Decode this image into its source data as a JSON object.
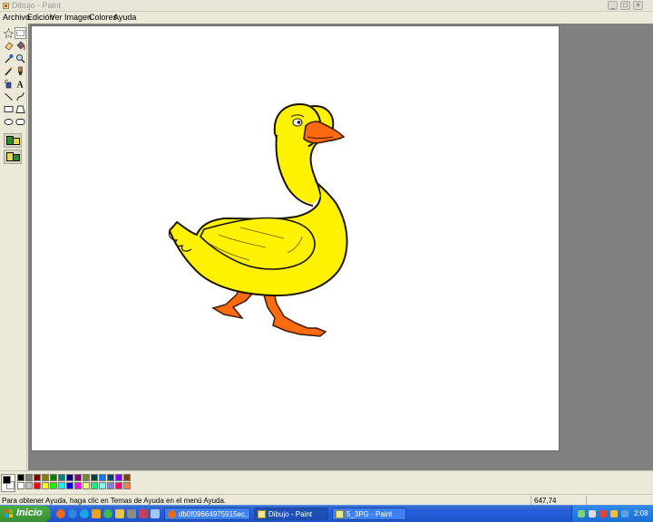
{
  "window": {
    "title": "Dibujo - Paint",
    "controls": {
      "minimize": "_",
      "maximize": "□",
      "close": "×"
    }
  },
  "menu": [
    "Archivo",
    "Edición",
    "Ver",
    "Imagen",
    "Colores",
    "Ayuda"
  ],
  "tools": [
    {
      "name": "free-form-select",
      "icon": "star-select-icon",
      "selected": false
    },
    {
      "name": "rect-select",
      "icon": "rect-select-icon",
      "selected": true
    },
    {
      "name": "eraser",
      "icon": "eraser-icon",
      "selected": false
    },
    {
      "name": "fill",
      "icon": "paint-bucket-icon",
      "selected": false
    },
    {
      "name": "pick-color",
      "icon": "eyedropper-icon",
      "selected": false
    },
    {
      "name": "magnifier",
      "icon": "magnifier-icon",
      "selected": false
    },
    {
      "name": "pencil",
      "icon": "pencil-icon",
      "selected": false
    },
    {
      "name": "brush",
      "icon": "brush-icon",
      "selected": false
    },
    {
      "name": "airbrush",
      "icon": "airbrush-icon",
      "selected": false
    },
    {
      "name": "text",
      "icon": "text-icon",
      "selected": false
    },
    {
      "name": "line",
      "icon": "line-icon",
      "selected": false
    },
    {
      "name": "curve",
      "icon": "curve-icon",
      "selected": false
    },
    {
      "name": "rectangle",
      "icon": "rectangle-icon",
      "selected": false
    },
    {
      "name": "polygon",
      "icon": "polygon-icon",
      "selected": false
    },
    {
      "name": "ellipse",
      "icon": "ellipse-icon",
      "selected": false
    },
    {
      "name": "rounded-rectangle",
      "icon": "rounded-rectangle-icon",
      "selected": false
    }
  ],
  "tool_options": [
    "opaque-selection-icon",
    "transparent-selection-icon"
  ],
  "colors": {
    "foreground": "#000000",
    "background": "#ffffff",
    "palette_row1": [
      "#000000",
      "#808080",
      "#800000",
      "#808000",
      "#008000",
      "#008080",
      "#000080",
      "#800080",
      "#808040",
      "#004040",
      "#0080ff",
      "#004080",
      "#8000ff",
      "#804000"
    ],
    "palette_row2": [
      "#ffffff",
      "#c0c0c0",
      "#ff0000",
      "#ffff00",
      "#00ff00",
      "#00ffff",
      "#0000ff",
      "#ff00ff",
      "#ffff80",
      "#00ff80",
      "#80ffff",
      "#8080ff",
      "#ff0080",
      "#ff8040"
    ]
  },
  "canvas_image": "duck-drawing",
  "status": {
    "help": "Para obtener Ayuda, haga clic en Temas de Ayuda en el menú Ayuda.",
    "coords": "647,74"
  },
  "taskbar": {
    "start_label": "Inicio",
    "quicklaunch_icons": [
      "firefox-icon",
      "ie-icon",
      "skype-icon",
      "media-icon",
      "msn-icon",
      "folder-icon",
      "winamp-icon",
      "clip-icon",
      "desktop-icon"
    ],
    "tasks": [
      {
        "label": "db0f09664975915ec...",
        "icon": "firefox-icon",
        "active": false
      },
      {
        "label": "Dibujo - Paint",
        "icon": "paint-icon",
        "active": true
      },
      {
        "label": "5_3PG - Paint",
        "icon": "paint-icon",
        "active": false
      }
    ],
    "tray_icons": [
      "network-icon",
      "volume-icon",
      "antivirus-icon",
      "update-icon",
      "shield-icon"
    ],
    "clock": "2:08"
  }
}
